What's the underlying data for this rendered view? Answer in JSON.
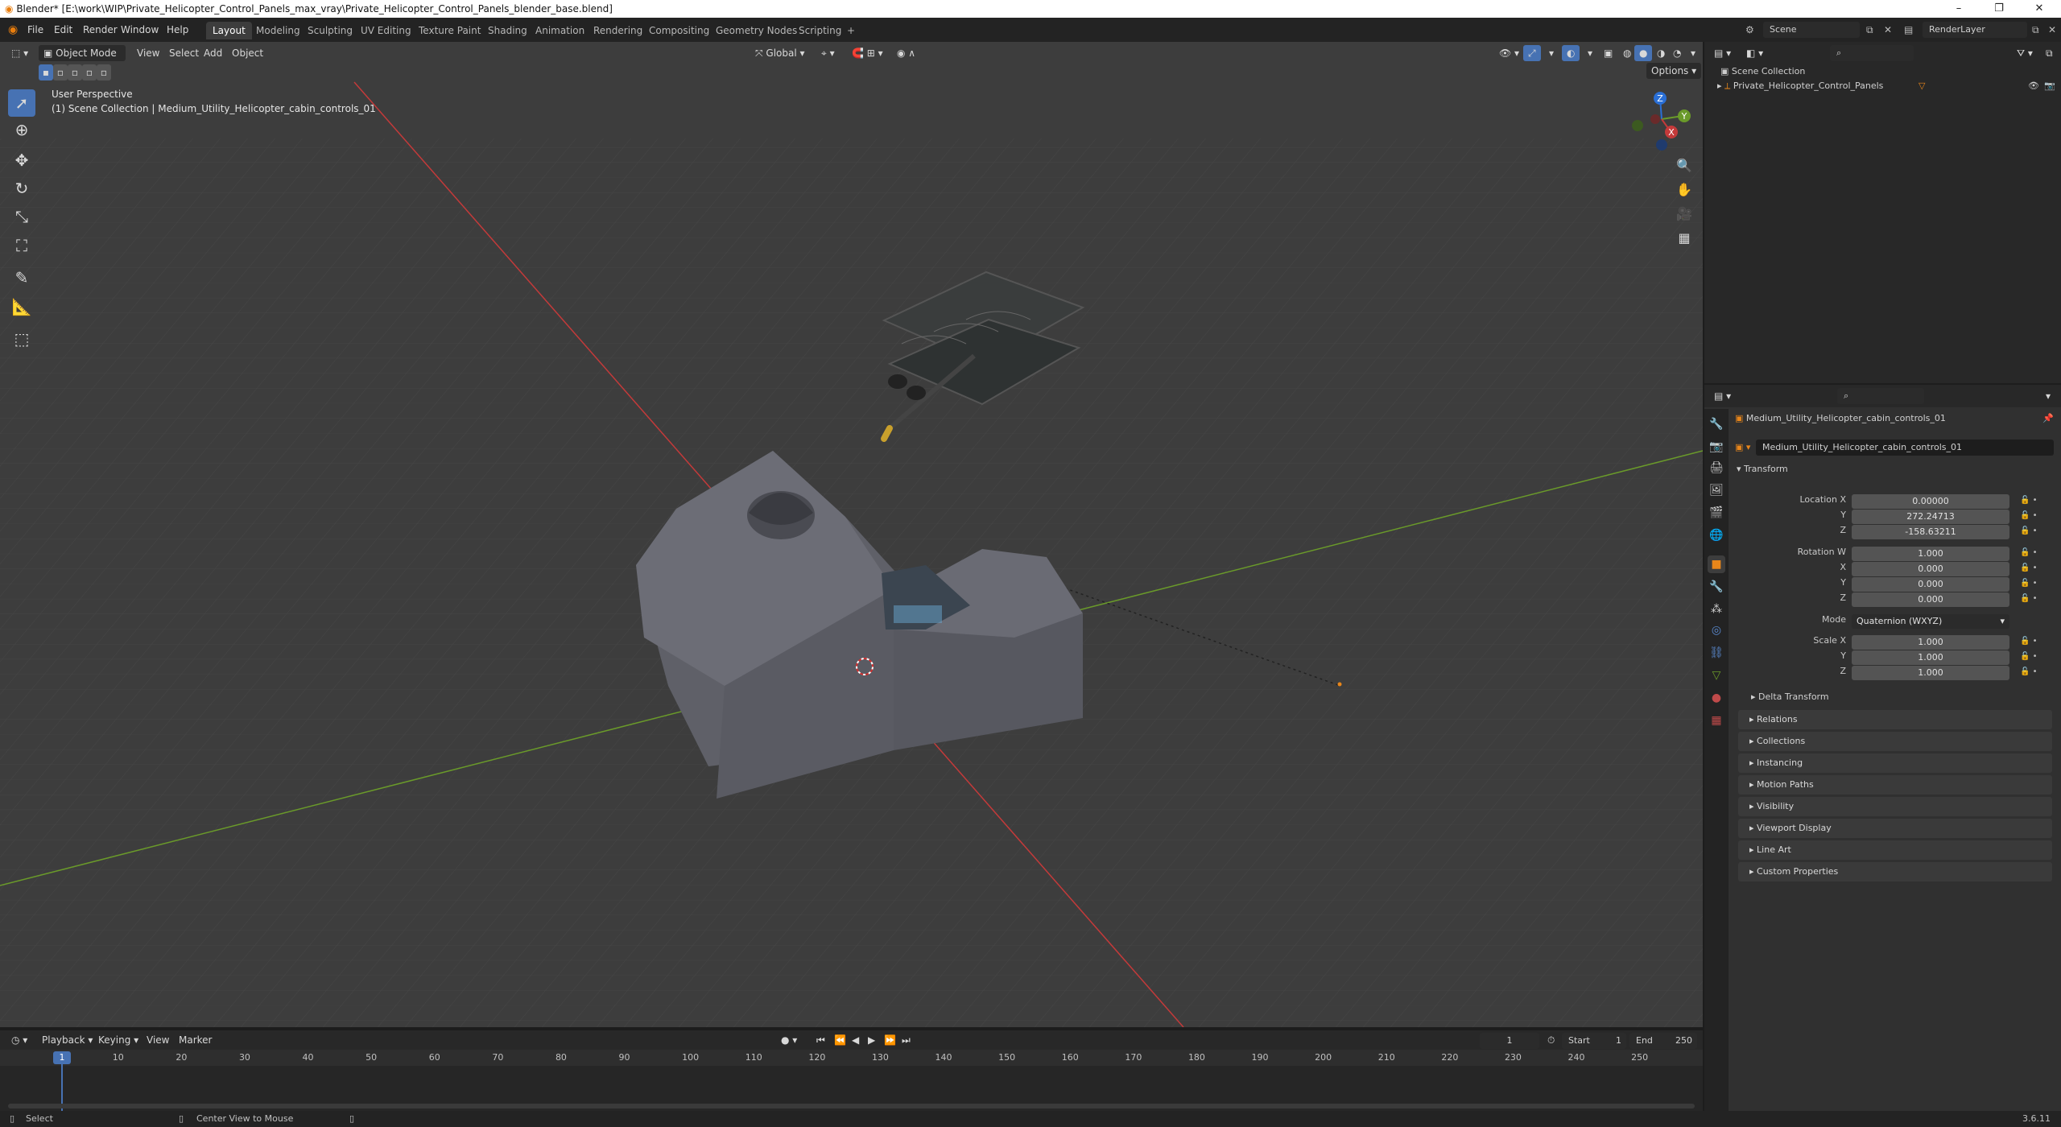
{
  "window": {
    "title": "Blender* [E:\\work\\WIP\\Private_Helicopter_Control_Panels_max_vray\\Private_Helicopter_Control_Panels_blender_base.blend]",
    "minimize": "–",
    "maximize": "❐",
    "close": "✕"
  },
  "menu": [
    "File",
    "Edit",
    "Render",
    "Window",
    "Help"
  ],
  "workspaces": [
    "Layout",
    "Modeling",
    "Sculpting",
    "UV Editing",
    "Texture Paint",
    "Shading",
    "Animation",
    "Rendering",
    "Compositing",
    "Geometry Nodes",
    "Scripting"
  ],
  "active_workspace": "Layout",
  "add_workspace": "+",
  "scene": {
    "name": "Scene",
    "view_layer": "RenderLayer"
  },
  "viewport": {
    "mode": "Object Mode",
    "menus": [
      "View",
      "Select",
      "Add",
      "Object"
    ],
    "transform_orientation": "Global",
    "options": "Options",
    "perspective": "User Perspective",
    "collection_info": "(1) Scene Collection | Medium_Utility_Helicopter_cabin_controls_01",
    "gizmo_axes": [
      "X",
      "Y",
      "Z"
    ]
  },
  "outliner": {
    "root": "Scene Collection",
    "items": [
      {
        "name": "Private_Helicopter_Control_Panels"
      }
    ]
  },
  "properties": {
    "object_name": "Medium_Utility_Helicopter_cabin_controls_01",
    "data_name": "Medium_Utility_Helicopter_cabin_controls_01",
    "transform_title": "Transform",
    "location": {
      "label": "Location X",
      "x": "0.00000",
      "y": "272.24713",
      "z": "-158.63211"
    },
    "rotation": {
      "label": "Rotation W",
      "w": "1.000",
      "x": "0.000",
      "y": "0.000",
      "z": "0.000"
    },
    "mode_label": "Mode",
    "mode_value": "Quaternion (WXYZ)",
    "scale": {
      "label": "Scale X",
      "x": "1.000",
      "y": "1.000",
      "z": "1.000"
    },
    "axis_labels": {
      "x": "X",
      "y": "Y",
      "z": "Z"
    },
    "delta_transform": "Delta Transform",
    "panels": [
      "Relations",
      "Collections",
      "Instancing",
      "Motion Paths",
      "Visibility",
      "Viewport Display",
      "Line Art",
      "Custom Properties"
    ]
  },
  "timeline": {
    "menus": [
      "Playback",
      "Keying",
      "View",
      "Marker"
    ],
    "current_frame": "1",
    "start_label": "Start",
    "start": "1",
    "end_label": "End",
    "end": "250",
    "ticks": [
      "1",
      "10",
      "20",
      "30",
      "40",
      "50",
      "60",
      "70",
      "80",
      "90",
      "100",
      "110",
      "120",
      "130",
      "140",
      "150",
      "160",
      "170",
      "180",
      "190",
      "200",
      "210",
      "220",
      "230",
      "240",
      "250"
    ]
  },
  "status": {
    "left": "Select",
    "middle": "Center View to Mouse",
    "version": "3.6.11"
  },
  "colors": {
    "accent": "#4772b3",
    "x_axis": "#c43a3a",
    "y_axis": "#6a9a2a",
    "z_axis": "#2a6fd6",
    "object": "#5f6068"
  }
}
